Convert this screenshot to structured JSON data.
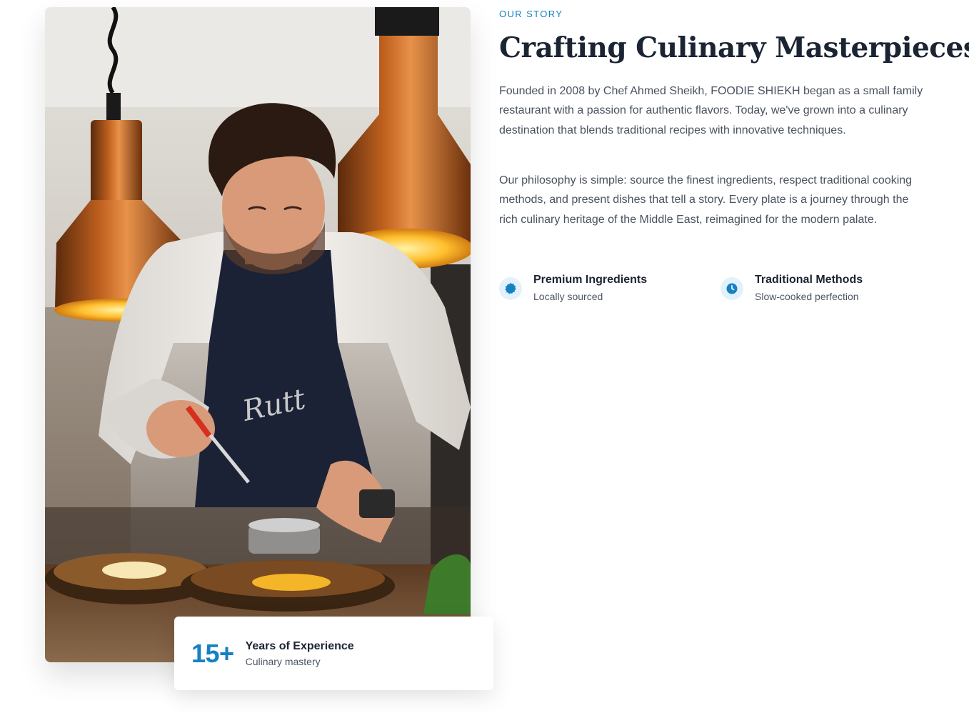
{
  "colors": {
    "accent": "#1581c4",
    "heading": "#1b2433",
    "body_text": "#4a5260",
    "icon_bg": "#e3f1fb"
  },
  "story": {
    "eyebrow": "OUR STORY",
    "title": "Crafting Culinary Masterpieces",
    "paragraphs": [
      "Founded in 2008 by Chef Ahmed Sheikh, FOODIE SHIEKH began as a small family restaurant with a passion for authentic flavors. Today, we've grown into a culinary destination that blends traditional recipes with innovative techniques.",
      "Our philosophy is simple: source the finest ingredients, respect traditional cooking methods, and present dishes that tell a story. Every plate is a journey through the rich culinary heritage of the Middle East, reimagined for the modern palate."
    ],
    "features": [
      {
        "icon": "badge-icon",
        "title": "Premium Ingredients",
        "subtitle": "Locally sourced"
      },
      {
        "icon": "clock-icon",
        "title": "Traditional Methods",
        "subtitle": "Slow-cooked perfection"
      }
    ]
  },
  "experience": {
    "number": "15+",
    "title": "Years of Experience",
    "subtitle": "Culinary mastery"
  },
  "image": {
    "subject": "chef plating food under copper heat lamps",
    "apron_text": "RUTT"
  }
}
